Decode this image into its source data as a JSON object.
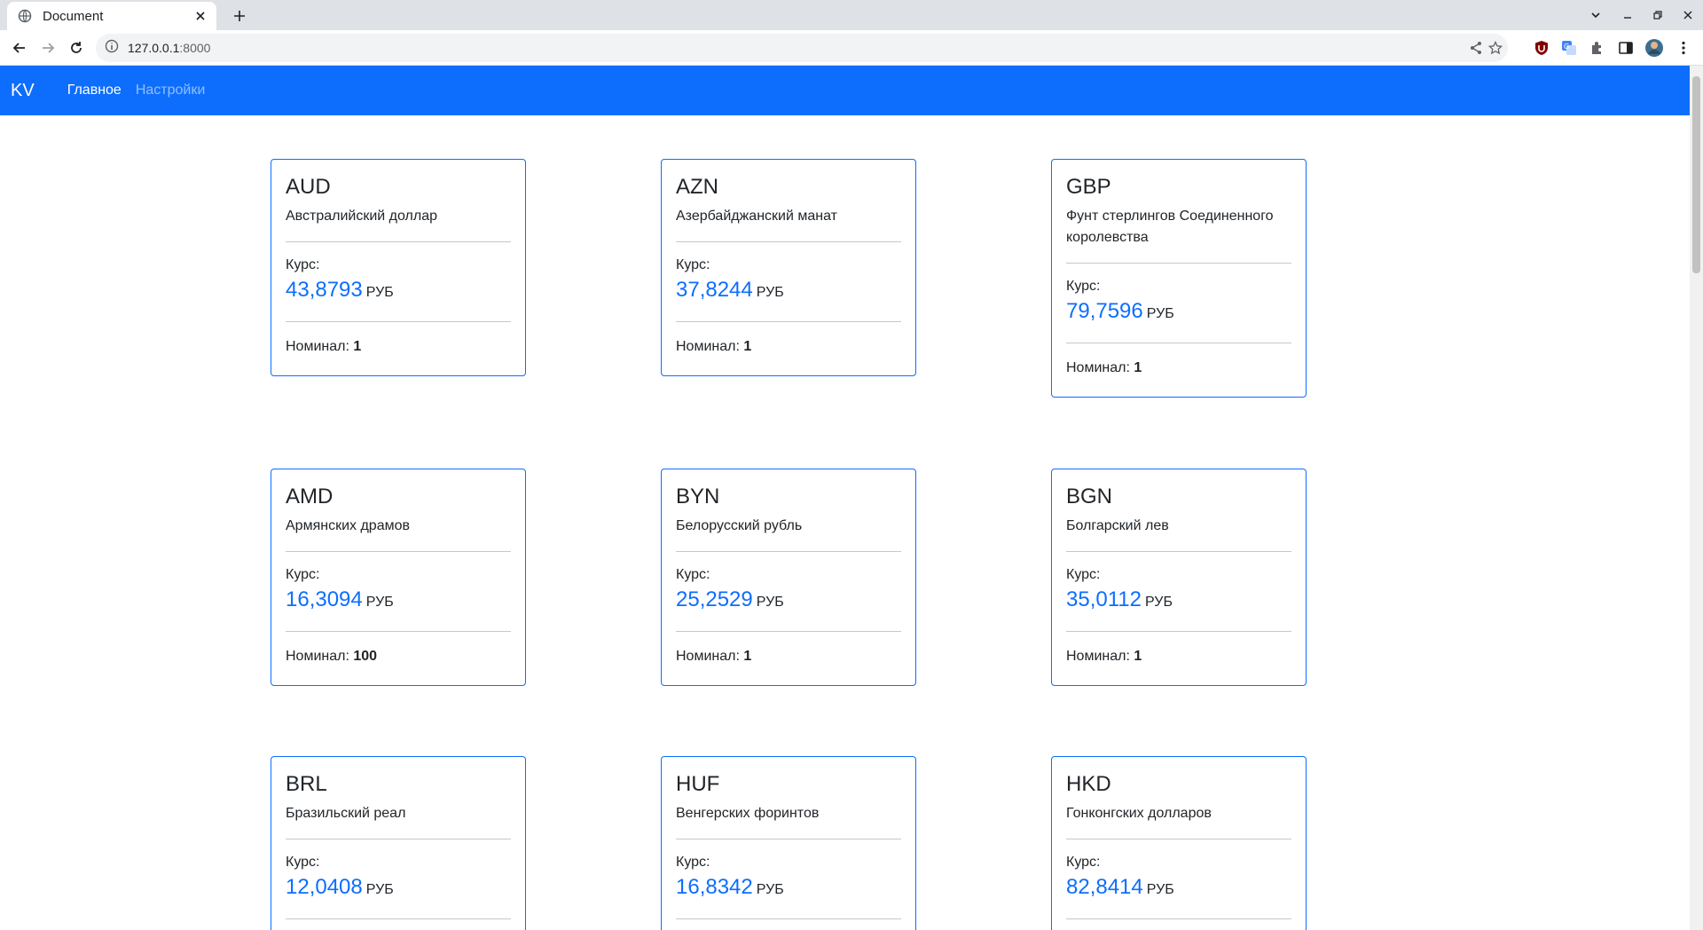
{
  "browser": {
    "tab_title": "Document",
    "url_host": "127.0.0.1",
    "url_port": ":8000"
  },
  "navbar": {
    "brand": "KV",
    "links": [
      {
        "label": "Главное",
        "active": true
      },
      {
        "label": "Настройки",
        "active": false
      }
    ]
  },
  "labels": {
    "rate": "Курс:",
    "unit": "РУБ",
    "nominal": "Номинал:"
  },
  "currencies": [
    {
      "code": "AUD",
      "name": "Австралийский доллар",
      "rate": "43,8793",
      "nominal": "1"
    },
    {
      "code": "AZN",
      "name": "Азербайджанский манат",
      "rate": "37,8244",
      "nominal": "1"
    },
    {
      "code": "GBP",
      "name": "Фунт стерлингов Соединенного королевства",
      "rate": "79,7596",
      "nominal": "1"
    },
    {
      "code": "AMD",
      "name": "Армянских драмов",
      "rate": "16,3094",
      "nominal": "100"
    },
    {
      "code": "BYN",
      "name": "Белорусский рубль",
      "rate": "25,2529",
      "nominal": "1"
    },
    {
      "code": "BGN",
      "name": "Болгарский лев",
      "rate": "35,0112",
      "nominal": "1"
    },
    {
      "code": "BRL",
      "name": "Бразильский реал",
      "rate": "12,0408",
      "nominal": ""
    },
    {
      "code": "HUF",
      "name": "Венгерских форинтов",
      "rate": "16,8342",
      "nominal": ""
    },
    {
      "code": "HKD",
      "name": "Гонконгских долларов",
      "rate": "82,8414",
      "nominal": ""
    }
  ],
  "colors": {
    "primary": "#0d6efd",
    "text": "#212529"
  }
}
